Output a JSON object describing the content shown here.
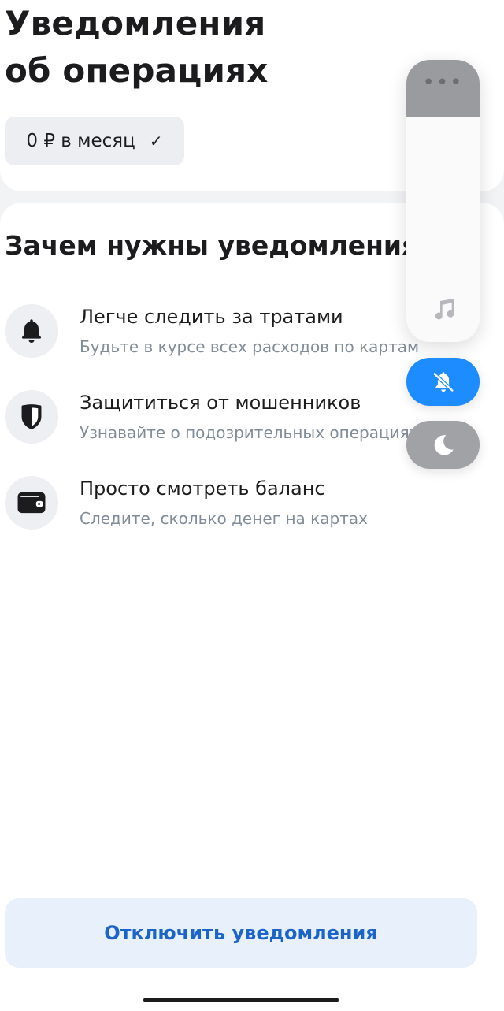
{
  "header": {
    "title_line1": "Уведомления",
    "title_line2": "об операциях",
    "price_label": "0 ₽ в месяц"
  },
  "section": {
    "title": "Зачем нужны уведомления"
  },
  "benefits": [
    {
      "icon": "bell-icon",
      "title": "Легче следить за тратами",
      "subtitle": "Будьте в курсе всех расходов по картам"
    },
    {
      "icon": "shield-icon",
      "title": "Защититься от мошенников",
      "subtitle": "Узнавайте о подозрительных операциях"
    },
    {
      "icon": "wallet-icon",
      "title": "Просто смотреть баланс",
      "subtitle": "Следите, сколько денег на картах"
    }
  ],
  "action": {
    "label": "Отключить уведомления"
  },
  "system_overlay": {
    "volume_level": 0.2,
    "silent_mode": true,
    "focus_mode": "do-not-disturb",
    "colors": {
      "mute_active": "#1d8cff",
      "volume_fill": "#9a9b9f"
    }
  },
  "colors": {
    "accent": "#1b65c8",
    "button_bg": "#e8f0fb",
    "secondary_text": "#818c99"
  }
}
